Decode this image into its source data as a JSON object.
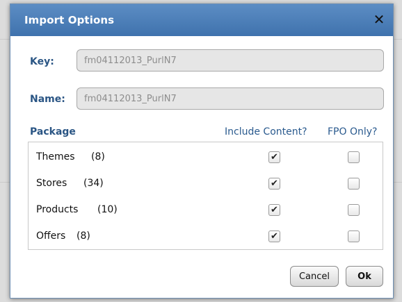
{
  "dialog": {
    "title": "Import Options",
    "close_icon": "✕"
  },
  "fields": {
    "key_label": "Key:",
    "key_value": "fm04112013_PurlN7",
    "name_label": "Name:",
    "name_value": "fm04112013_PurlN7"
  },
  "packages": {
    "header_package": "Package",
    "header_include": "Include Content?",
    "header_fpo": "FPO Only?",
    "rows": [
      {
        "name": "Themes",
        "count": "(8)",
        "include_content": true,
        "fpo_only": false
      },
      {
        "name": "Stores",
        "count": "(34)",
        "include_content": true,
        "fpo_only": false
      },
      {
        "name": "Products",
        "count": "(10)",
        "include_content": true,
        "fpo_only": false
      },
      {
        "name": "Offers",
        "count": "(8)",
        "include_content": true,
        "fpo_only": false
      }
    ]
  },
  "buttons": {
    "cancel_label": "Cancel",
    "ok_label": "Ok"
  },
  "colors": {
    "titlebar": "#4a7db8",
    "label_text": "#2a5584"
  }
}
